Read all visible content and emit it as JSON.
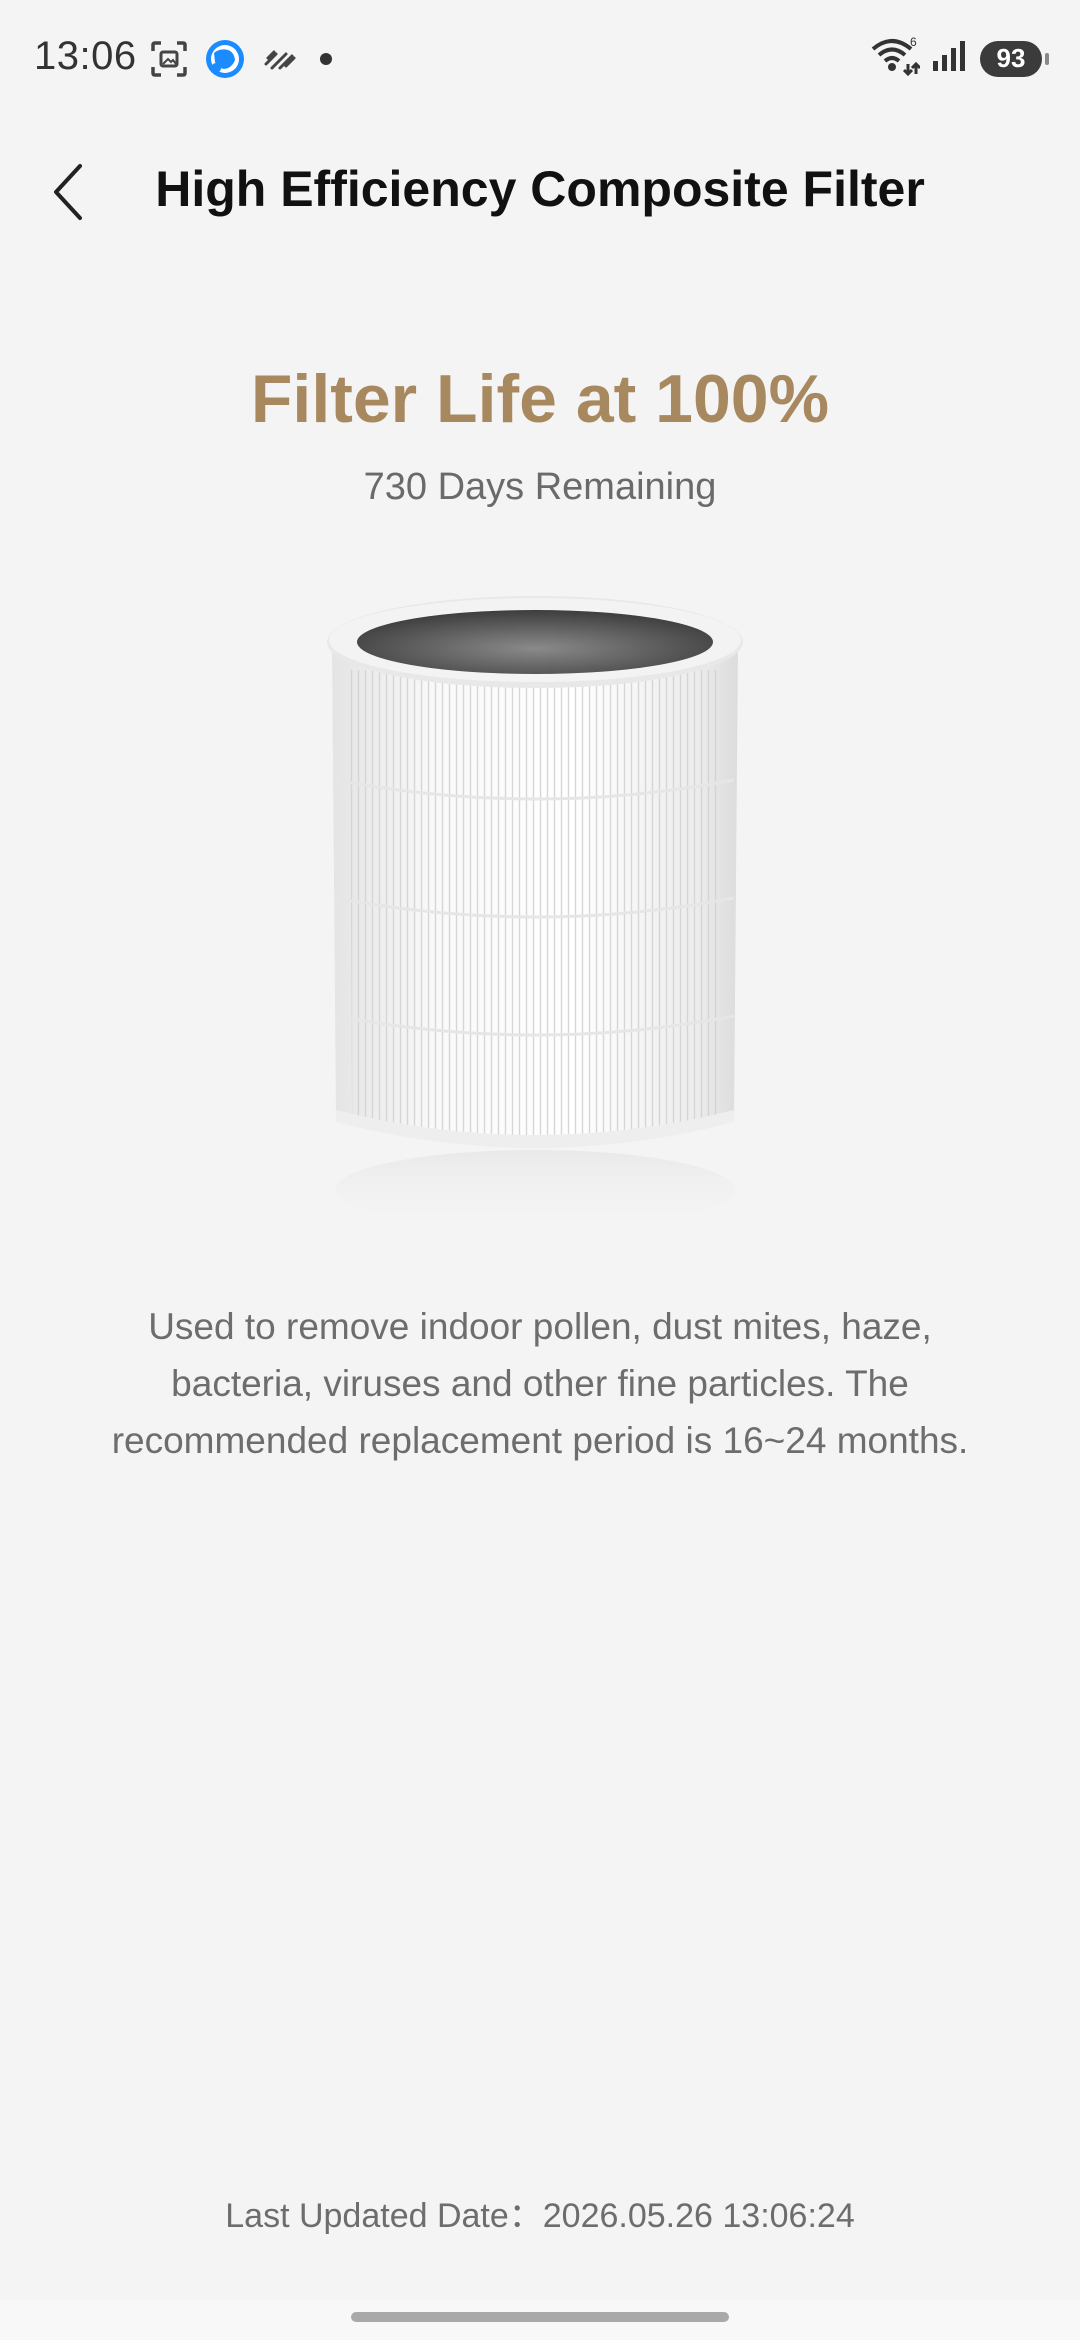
{
  "status_bar": {
    "time": "13:06",
    "battery": "93",
    "icons": [
      "screenshot-icon",
      "browser-icon",
      "haze-icon",
      "notification-dot-icon",
      "wifi-icon",
      "signal-icon",
      "battery-icon"
    ]
  },
  "header": {
    "title": "High Efficiency Composite Filter"
  },
  "filter": {
    "life_title": "Filter Life at 100%",
    "life_percent": 100,
    "remaining": "730 Days Remaining",
    "description": "Used to remove indoor pollen, dust mites, haze, bacteria, viruses and other fine particles. The recommended replacement period is 16~24 months.",
    "last_updated": "Last Updated Date：2026.05.26 13:06:24"
  },
  "colors": {
    "accent": "#a8895f",
    "background": "#f4f4f4",
    "title": "#111111",
    "secondary_text": "#6d6d6d"
  }
}
